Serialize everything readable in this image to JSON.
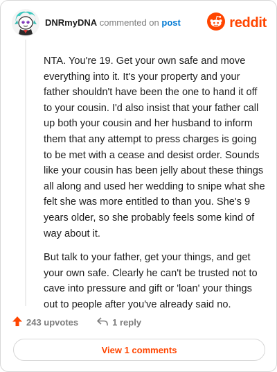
{
  "header": {
    "author": "DNRmyDNA",
    "commented_text": "commented on",
    "post_link": "post",
    "brand": "reddit",
    "avatar_icon": "snoo-avatar-icon",
    "brand_icon": "reddit-logo-icon"
  },
  "comment": {
    "paragraphs": [
      "NTA. You're 19. Get your own safe and move everything into it. It's your property and your father shouldn't have been the one to hand it off to your cousin. I'd also insist that your father call up both your cousin and her husband to inform them that any attempt to press charges is going to be met with a cease and desist order. Sounds like your cousin has been jelly about these things all along and used her wedding to snipe what she felt she was more entitled to than you. She's 9 years older, so she probably feels some kind of way about it.",
      "But talk to your father, get your things, and get your own safe. Clearly he can't be trusted not to cave into pressure and gift or 'loan' your things out to people after you've already said no."
    ]
  },
  "actions": {
    "upvotes": "243 upvotes",
    "replies": "1 reply",
    "upvote_icon": "upvote-arrow-icon",
    "reply_icon": "reply-arrow-icon"
  },
  "view_comments": "View 1 comments",
  "colors": {
    "brand": "#ff4500",
    "link": "#0079d3",
    "muted": "#7c7c7c",
    "text": "#1c1c1c",
    "border": "#d7d7d7"
  }
}
